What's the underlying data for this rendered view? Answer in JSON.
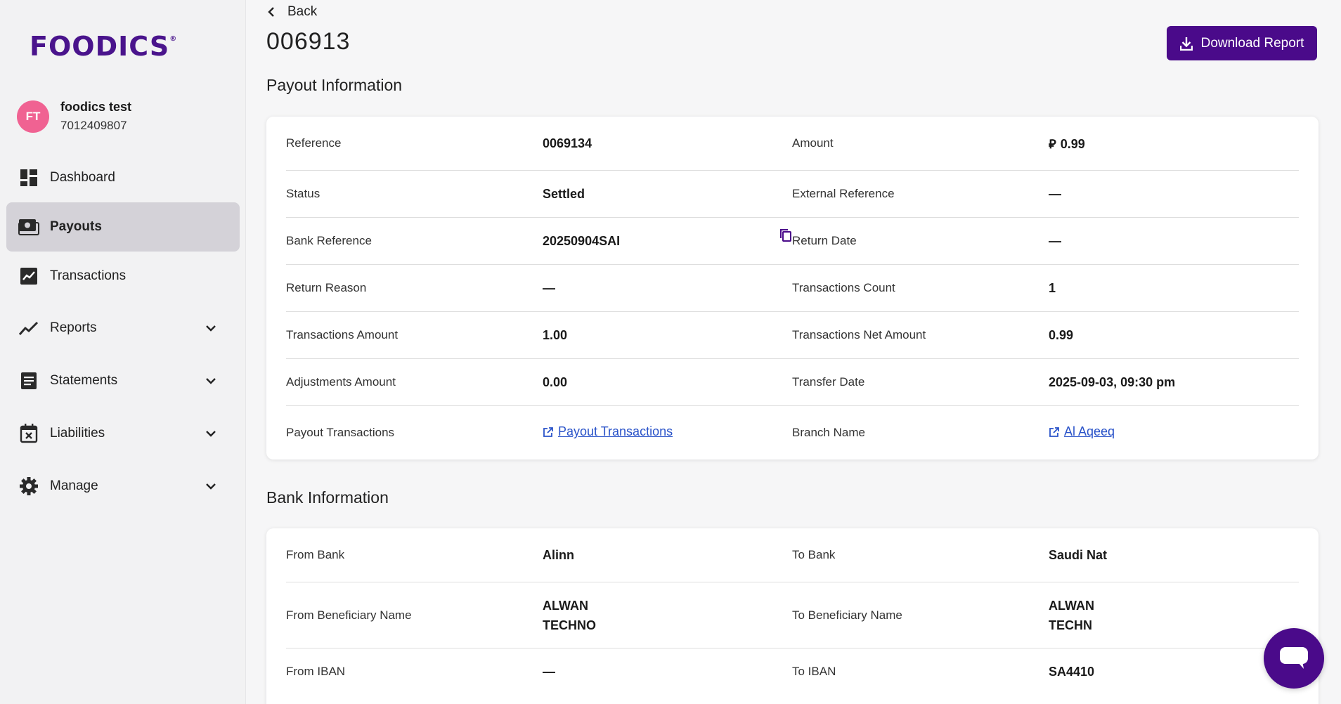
{
  "brand": {
    "logo_text": "FOODICS",
    "accent": "#4a0a8a"
  },
  "user": {
    "initials": "FT",
    "name": "foodics test",
    "phone": "7012409807"
  },
  "sidebar": {
    "items": [
      {
        "label": "Dashboard",
        "icon": "dashboard-icon"
      },
      {
        "label": "Payouts",
        "icon": "payouts-icon",
        "active": true
      },
      {
        "label": "Transactions",
        "icon": "transactions-icon"
      },
      {
        "label": "Reports",
        "icon": "reports-icon",
        "expandable": true
      },
      {
        "label": "Statements",
        "icon": "statements-icon",
        "expandable": true
      },
      {
        "label": "Liabilities",
        "icon": "liabilities-icon",
        "expandable": true
      },
      {
        "label": "Manage",
        "icon": "gear-icon",
        "expandable": true
      }
    ]
  },
  "header": {
    "back_label": "Back",
    "title": "006913",
    "download_label": "Download Report"
  },
  "payout_info": {
    "section_title": "Payout Information",
    "rows": [
      {
        "l1": "Reference",
        "v1": "0069134",
        "l2": "Amount",
        "v2": "0.99",
        "currency_glyph": "⃁"
      },
      {
        "l1": "Status",
        "v1": "Settled",
        "l2": "External Reference",
        "v2": "—"
      },
      {
        "l1": "Bank Reference",
        "v1": "20250904SAI",
        "l2": "Return Date",
        "v2": "—"
      },
      {
        "l1": "Return Reason",
        "v1": "—",
        "l2": "Transactions Count",
        "v2": "1"
      },
      {
        "l1": "Transactions Amount",
        "v1": "1.00",
        "l2": "Transactions Net Amount",
        "v2": "0.99"
      },
      {
        "l1": "Adjustments Amount",
        "v1": "0.00",
        "l2": "Transfer Date",
        "v2": "2025-09-03, 09:30 pm"
      },
      {
        "l1": "Payout Transactions",
        "v1": "Payout Transactions",
        "l2": "Branch Name",
        "v2": "Al Aqeeq"
      }
    ]
  },
  "bank_info": {
    "section_title": "Bank Information",
    "rows": [
      {
        "l1": "From Bank",
        "v1": "Alinn",
        "l2": "To Bank",
        "v2": "Saudi Nat"
      },
      {
        "l1": "From Beneficiary Name",
        "v1a": "ALWAN",
        "v1b": "TECHNO",
        "l2": "To Beneficiary Name",
        "v2a": "ALWAN",
        "v2b": "TECHN"
      },
      {
        "l1": "From IBAN",
        "v1": "—",
        "l2": "To IBAN",
        "v2": "SA4410"
      }
    ]
  }
}
